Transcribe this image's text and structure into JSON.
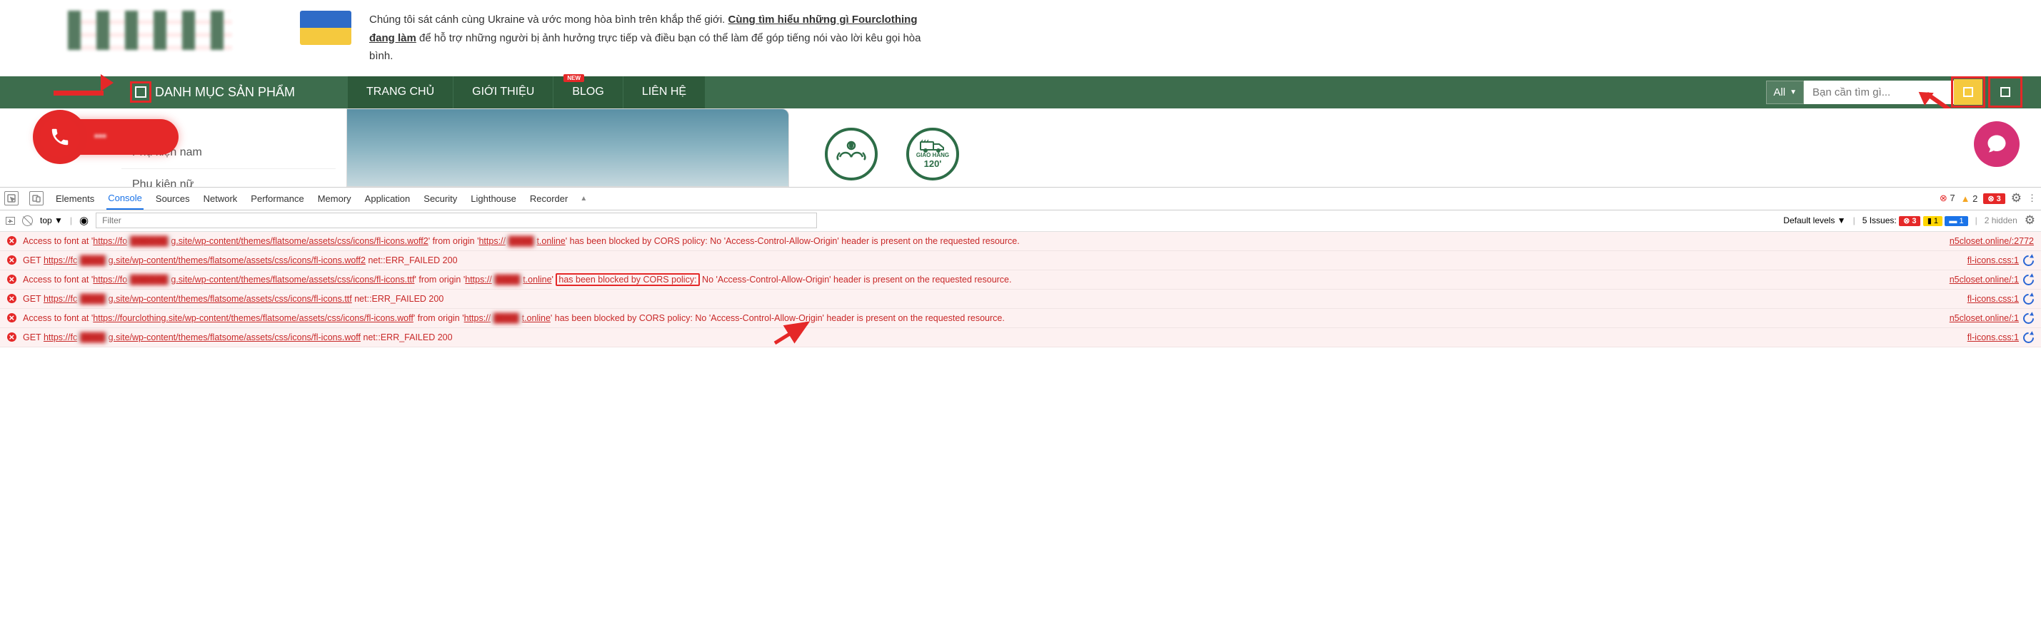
{
  "banner": {
    "text_prefix": "Chúng tôi sát cánh cùng Ukraine và ước mong hòa bình trên khắp thế giới. ",
    "text_bold": "Cùng tìm hiểu những gì Fourclothing đang làm",
    "text_suffix": " để hỗ trợ những người bị ảnh hưởng trực tiếp và điều bạn có thể làm để góp tiếng nói vào lời kêu gọi hòa bình."
  },
  "nav": {
    "category_label": "DANH MỤC SẢN PHẨM",
    "items": [
      {
        "label": "TRANG CHỦ"
      },
      {
        "label": "GIỚI THIỆU"
      },
      {
        "label": "BLOG",
        "new": true
      },
      {
        "label": "LIÊN HỆ"
      }
    ]
  },
  "search": {
    "filter": "All",
    "placeholder": "Bạn cần tìm gì..."
  },
  "sidebar": {
    "items": [
      {
        "label": "Phụ kiện nam"
      },
      {
        "label": "Phụ kiện nữ"
      }
    ]
  },
  "badges": {
    "b1_line1": "$",
    "b2_line1": "GIAO HÀNG",
    "b2_line2": "120'"
  },
  "call": {
    "phone_masked": "•••"
  },
  "devtools": {
    "tabs": [
      "Elements",
      "Console",
      "Sources",
      "Network",
      "Performance",
      "Memory",
      "Application",
      "Security",
      "Lighthouse",
      "Recorder"
    ],
    "active_tab": "Console",
    "badge_errors": "7",
    "badge_warnings": "2",
    "badge_ext_errors": "3",
    "controls": {
      "context": "top",
      "filter_placeholder": "Filter",
      "levels": "Default levels",
      "issues_label": "5 Issues:",
      "issues_err": "3",
      "issues_warn": "1",
      "issues_info": "1",
      "hidden": "2 hidden"
    },
    "logs": [
      {
        "type": "error",
        "msg_segments": [
          {
            "t": "Access to font at '"
          },
          {
            "t": "https://fo",
            "u": true
          },
          {
            "t": "██████",
            "blur": true,
            "u": true
          },
          {
            "t": "g.site/wp-content/themes/flatsome/assets/css/icons/fl-icons.woff2",
            "u": true
          },
          {
            "t": "' from origin '"
          },
          {
            "t": "https://",
            "u": true
          },
          {
            "t": "████",
            "blur": true,
            "u": true
          },
          {
            "t": "t.online",
            "u": true
          },
          {
            "t": "' has been blocked by CORS policy: No 'Access-Control-Allow-Origin' header is present on the requested resource."
          }
        ],
        "source": "n5closet.online/:2772"
      },
      {
        "type": "error",
        "msg_segments": [
          {
            "t": "GET "
          },
          {
            "t": "https://fc",
            "u": true
          },
          {
            "t": "████",
            "blur": true,
            "u": true
          },
          {
            "t": "g.site/wp-content/themes/flatsome/assets/css/icons/fl-icons.woff2",
            "u": true
          },
          {
            "t": " net::ERR_FAILED 200"
          }
        ],
        "source": "fl-icons.css:1",
        "reload": true
      },
      {
        "type": "error",
        "msg_segments": [
          {
            "t": "Access to font at '"
          },
          {
            "t": "https://fo",
            "u": true
          },
          {
            "t": "██████",
            "blur": true,
            "u": true
          },
          {
            "t": "g.site/wp-content/themes/flatsome/assets/css/icons/fl-icons.ttf",
            "u": true
          },
          {
            "t": "' from origin '"
          },
          {
            "t": "https://",
            "u": true
          },
          {
            "t": "████",
            "blur": true,
            "u": true
          },
          {
            "t": "t.online",
            "u": true
          },
          {
            "t": "' "
          },
          {
            "t": "has been blocked by CORS policy:",
            "hl": true
          },
          {
            "t": " No 'Access-Control-Allow-Origin' header is present on the requested resource."
          }
        ],
        "source": "n5closet.online/:1",
        "reload": true
      },
      {
        "type": "error",
        "msg_segments": [
          {
            "t": "GET "
          },
          {
            "t": "https://fc",
            "u": true
          },
          {
            "t": "████",
            "blur": true,
            "u": true
          },
          {
            "t": "g.site/wp-content/themes/flatsome/assets/css/icons/fl-icons.ttf",
            "u": true
          },
          {
            "t": " net::ERR_FAILED 200"
          }
        ],
        "source": "fl-icons.css:1",
        "reload": true
      },
      {
        "type": "error",
        "msg_segments": [
          {
            "t": "Access to font at '"
          },
          {
            "t": "https://fourclothing.site/wp-content/themes/flatsome/assets/css/icons/fl-icons.woff",
            "u": true
          },
          {
            "t": "' from origin '"
          },
          {
            "t": "https://",
            "u": true
          },
          {
            "t": "████",
            "blur": true,
            "u": true
          },
          {
            "t": "t.online",
            "u": true
          },
          {
            "t": "' has been blocked by CORS policy: No 'Access-Control-Allow-Origin' header is present on the requested resource."
          }
        ],
        "source": "n5closet.online/:1",
        "reload": true
      },
      {
        "type": "error",
        "msg_segments": [
          {
            "t": "GET "
          },
          {
            "t": "https://fc",
            "u": true
          },
          {
            "t": "████",
            "blur": true,
            "u": true
          },
          {
            "t": "g.site/wp-content/themes/flatsome/assets/css/icons/fl-icons.woff",
            "u": true
          },
          {
            "t": " net::ERR_FAILED 200"
          }
        ],
        "source": "fl-icons.css:1",
        "reload": true
      }
    ]
  }
}
